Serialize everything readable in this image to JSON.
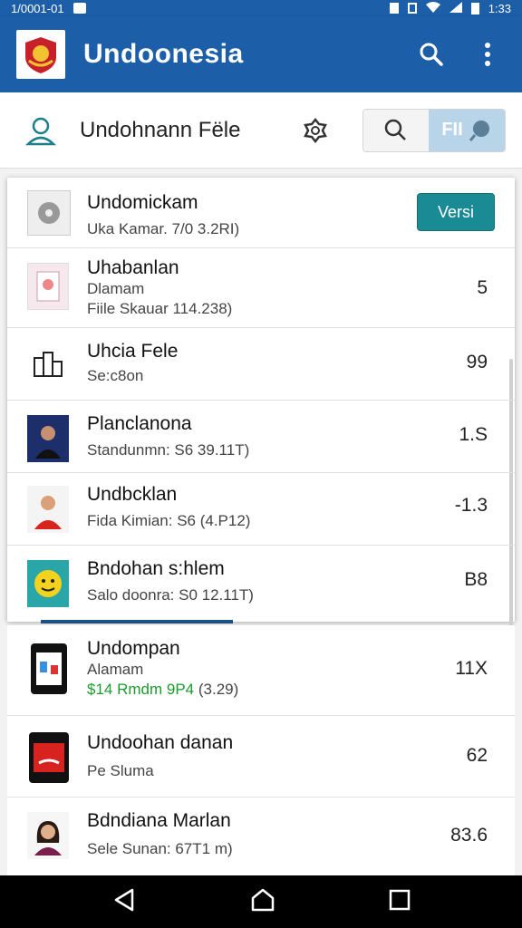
{
  "status_bar": {
    "left_text": "1/0001-01",
    "time": "1:33"
  },
  "app_bar": {
    "title": "Undoonesia",
    "search_icon": "search-icon",
    "menu_icon": "more-vert-icon",
    "brand_color": "#1d5ea8"
  },
  "sub_header": {
    "title": "Undohnann Fële",
    "toggle_label": "FII"
  },
  "card_rows": [
    {
      "title": "Undomickam",
      "line1": "Uka Kamar. 7/0 3.2RI)",
      "line2": "",
      "value": "",
      "button": "Versi"
    },
    {
      "title": "Uhabanlan",
      "line1": "Dlamam",
      "line2": "Fiile Skauar 114.238)",
      "value": "5"
    },
    {
      "title": "Uhcia Fele",
      "line1": "Se:c8on",
      "line2": "",
      "value": "99"
    },
    {
      "title": "Planclanona",
      "line1": "Standunmn: S6 39.11T)",
      "line2": "",
      "value": "1.S"
    },
    {
      "title": "Undbcklan",
      "line1": "Fida Kimian: S6 (4.P12)",
      "line2": "",
      "value": "-1.3"
    },
    {
      "title": "Bndohan s:hlem",
      "line1": "Salo doonra: S0 12.11T)",
      "line2": "",
      "value": "B8"
    }
  ],
  "list_rows": [
    {
      "title": "Undompan",
      "line1": "Alamam",
      "line2_green": "$14 Rmdm 9P4",
      "line2_rest": "(3.29)",
      "value": "11X"
    },
    {
      "title": "Undoohan danan",
      "line1": "Pe Sluma",
      "value": "62"
    },
    {
      "title": "Bdndiana Marlan",
      "line1": "Sele Sunan: 67T1 m)",
      "value": "83.6"
    }
  ],
  "accent_color": "#1a8a94"
}
